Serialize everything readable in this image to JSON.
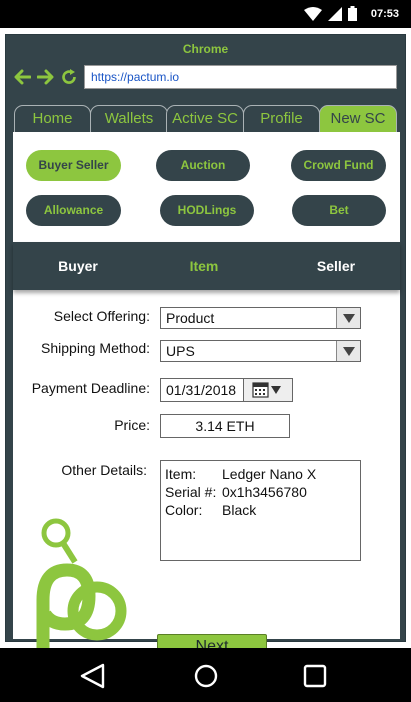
{
  "status_bar": {
    "time": "07:53",
    "icons": [
      "wifi-icon",
      "signal-icon",
      "battery-icon"
    ]
  },
  "browser": {
    "title": "Chrome",
    "url": "https://pactum.io",
    "nav_icons": [
      "back-arrow-icon",
      "forward-arrow-icon",
      "reload-icon"
    ]
  },
  "tabs": [
    "Home",
    "Wallets",
    "Active SC",
    "Profile",
    "New SC"
  ],
  "active_tab": "New SC",
  "contract_types": [
    "Buyer Seller",
    "Auction",
    "Crowd Fund",
    "Allowance",
    "HODLings",
    "Bet"
  ],
  "active_contract_type": "Buyer Seller",
  "roles": [
    "Buyer",
    "Item",
    "Seller"
  ],
  "active_role": "Item",
  "form": {
    "offering_label": "Select Offering:",
    "offering_value": "Product",
    "shipping_label": "Shipping Method:",
    "shipping_value": "UPS",
    "deadline_label": "Payment Deadline:",
    "deadline_value": "01/31/2018",
    "price_label": "Price:",
    "price_value": "3.14 ETH",
    "details_label": "Other Details:",
    "details": [
      {
        "key": "Item:",
        "value": "Ledger Nano X"
      },
      {
        "key": "Serial #:",
        "value": "0x1h3456780"
      },
      {
        "key": "Color:",
        "value": "Black"
      }
    ],
    "next_label": "Next"
  },
  "colors": {
    "accent_green": "#8dc63f",
    "dark_slate": "#34444a",
    "url_blue": "#1a55c6"
  },
  "android_nav": [
    "back-triangle-icon",
    "home-circle-icon",
    "recents-square-icon"
  ]
}
